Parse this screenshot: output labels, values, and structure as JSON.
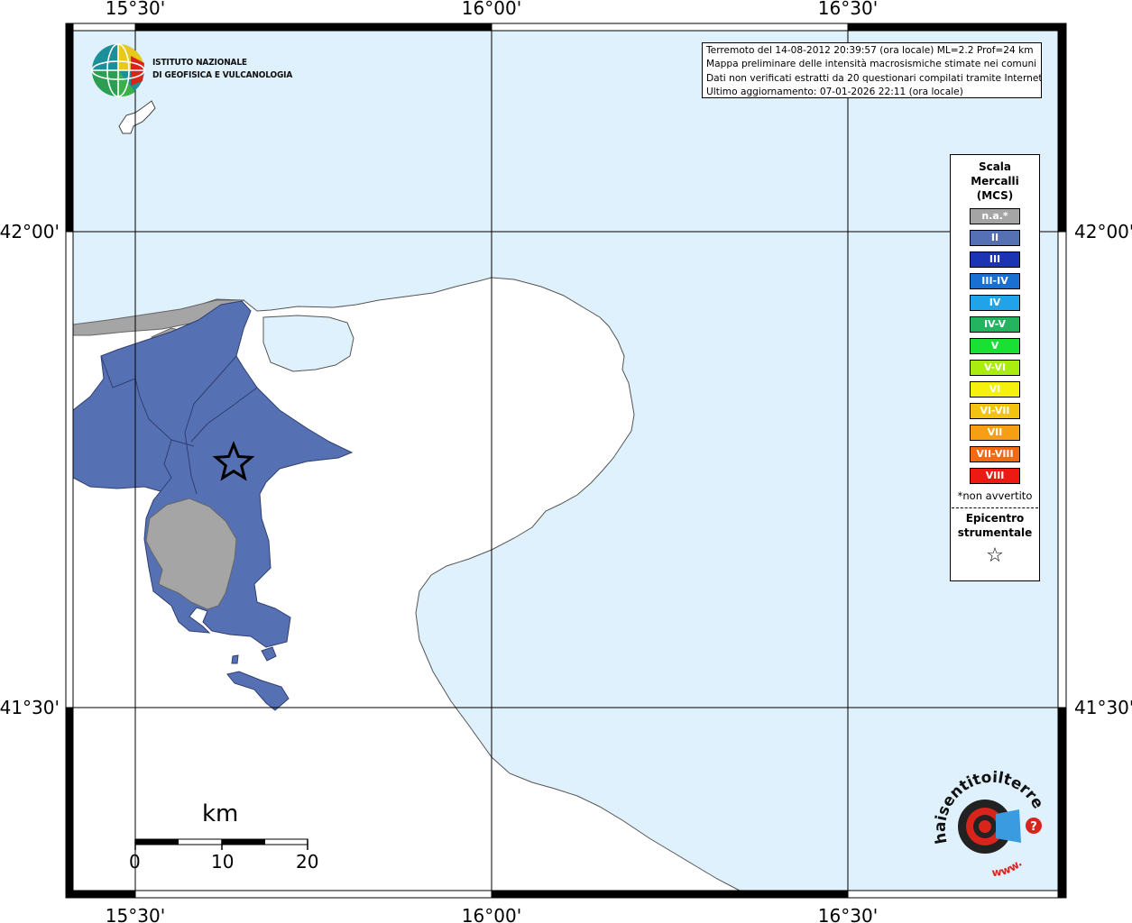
{
  "axes": {
    "top_labels": [
      "15°30'",
      "16°00'",
      "16°30'"
    ],
    "bottom_labels": [
      "15°30'",
      "16°00'",
      "16°30'"
    ],
    "left_labels": [
      "42°00'",
      "41°30'"
    ],
    "right_labels": [
      "42°00'",
      "41°30'"
    ]
  },
  "colors": {
    "sea": "#dff1fc",
    "land": "#ffffff",
    "intensity_II": "#5670b4",
    "not_available": "#a5a5a5",
    "coast_line": "#444444"
  },
  "logo": {
    "institute_line1": "ISTITUTO NAZIONALE",
    "institute_line2": "DI GEOFISICA E VULCANOLOGIA"
  },
  "info": {
    "line1": "Terremoto del 14-08-2012 20:39:57 (ora locale) ML=2.2 Prof=24 km",
    "line2": "Mappa preliminare delle intensità macrosismiche stimate nei comuni",
    "line3": "Dati non verificati estratti da 20 questionari compilati tramite Internet.",
    "line4": "Ultimo aggiornamento: 07-01-2026 22:11 (ora locale)"
  },
  "legend": {
    "title": "Scala Mercalli (MCS)",
    "items": [
      {
        "label": "n.a.*",
        "color": "#a5a5a5"
      },
      {
        "label": "II",
        "color": "#5670b4"
      },
      {
        "label": "III",
        "color": "#1c33b4"
      },
      {
        "label": "III-IV",
        "color": "#1a6fd2"
      },
      {
        "label": "IV",
        "color": "#21a3e9"
      },
      {
        "label": "IV-V",
        "color": "#24b45f"
      },
      {
        "label": "V",
        "color": "#19e032"
      },
      {
        "label": "V-VI",
        "color": "#aaec10"
      },
      {
        "label": "VI",
        "color": "#f6f00e"
      },
      {
        "label": "VI-VII",
        "color": "#f4c310"
      },
      {
        "label": "VII",
        "color": "#f79f14"
      },
      {
        "label": "VII-VIII",
        "color": "#f26b14"
      },
      {
        "label": "VIII",
        "color": "#ec1a13"
      }
    ],
    "note": "*non avvertito",
    "epicenter_label": "Epicentro strumentale"
  },
  "scale_bar": {
    "unit": "km",
    "ticks": [
      "0",
      "10",
      "20"
    ]
  },
  "bottom_logo": {
    "arc_text": "haisentitoilterremoto.it",
    "www_text": "www.",
    "question_mark": "?"
  }
}
